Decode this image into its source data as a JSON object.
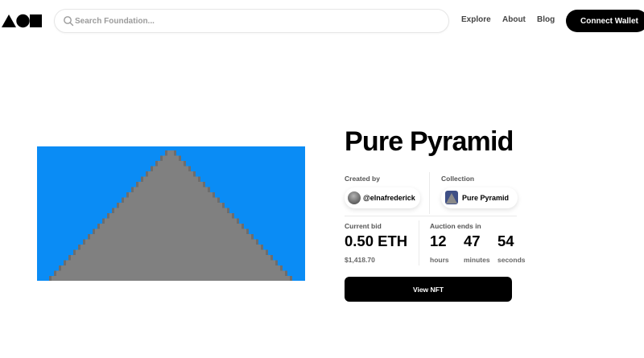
{
  "header": {
    "search_placeholder": "Search Foundation...",
    "nav": [
      {
        "label": "Explore"
      },
      {
        "label": "About"
      },
      {
        "label": "Blog"
      }
    ],
    "connect_wallet_label": "Connect Wallet"
  },
  "nft": {
    "title": "Pure Pyramid",
    "artwork_colors": {
      "sky": "#0a8cf5",
      "pyramid": "#808080",
      "edge": "#6d6d6d"
    },
    "created_by_label": "Created by",
    "creator_handle": "@elnafrederick",
    "collection_label": "Collection",
    "collection_name": "Pure Pyramid",
    "current_bid_label": "Current bid",
    "current_bid": "0.50 ETH",
    "current_bid_usd": "$1,418.70",
    "auction_label": "Auction ends in",
    "countdown": [
      {
        "value": "12",
        "unit": "hours"
      },
      {
        "value": "47",
        "unit": "minutes"
      },
      {
        "value": "54",
        "unit": "seconds"
      }
    ],
    "view_button_label": "View NFT"
  }
}
